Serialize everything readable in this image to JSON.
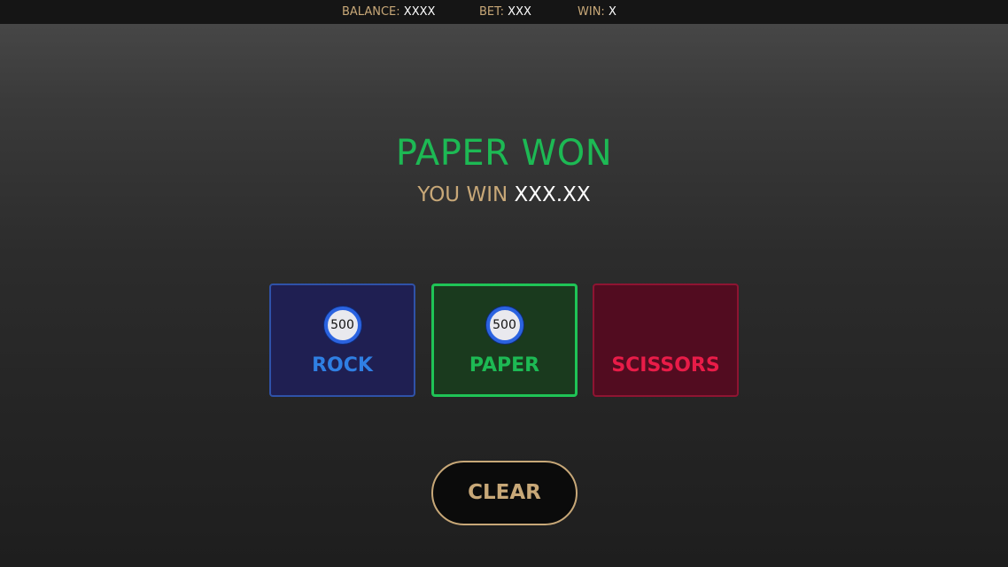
{
  "header": {
    "balance_label": "BALANCE:",
    "balance_value": "XXXX",
    "bet_label": "BET:",
    "bet_value": "XXX",
    "win_label": "WIN:",
    "win_value": "X"
  },
  "result": {
    "title": "PAPER WON",
    "win_label": "YOU WIN",
    "win_amount": "XXX.XX"
  },
  "bets": {
    "rock": {
      "label": "ROCK",
      "chip": "500"
    },
    "paper": {
      "label": "PAPER",
      "chip": "500",
      "selected": true
    },
    "scissors": {
      "label": "SCISSORS"
    }
  },
  "controls": {
    "clear_label": "CLEAR"
  },
  "colors": {
    "accent_gold": "#c8a878",
    "win_green": "#1db954",
    "rock_blue": "#2f7fe3",
    "scissors_red": "#e81c48"
  }
}
